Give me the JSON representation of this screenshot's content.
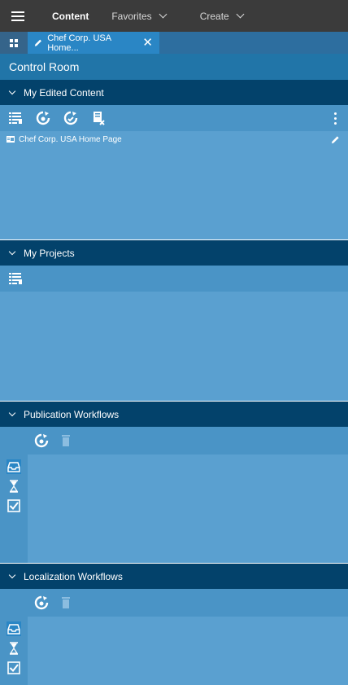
{
  "topnav": {
    "content_label": "Content",
    "favorites_label": "Favorites",
    "create_label": "Create"
  },
  "tabs": {
    "doc_label": "Chef Corp. USA Home...",
    "close_glyph": "✕"
  },
  "control_room": {
    "title": "Control Room"
  },
  "sections": {
    "edited": {
      "title": "My Edited Content",
      "items": [
        {
          "label": "Chef Corp. USA Home Page"
        }
      ]
    },
    "projects": {
      "title": "My Projects"
    },
    "publication": {
      "title": "Publication Workflows"
    },
    "localization": {
      "title": "Localization Workflows"
    }
  },
  "colors": {
    "topbar": "#3b3b3b",
    "section_header": "#03426b",
    "toolbar": "#4a94c6",
    "panel": "#5aa0d0",
    "tab_active": "#2a86c5"
  }
}
